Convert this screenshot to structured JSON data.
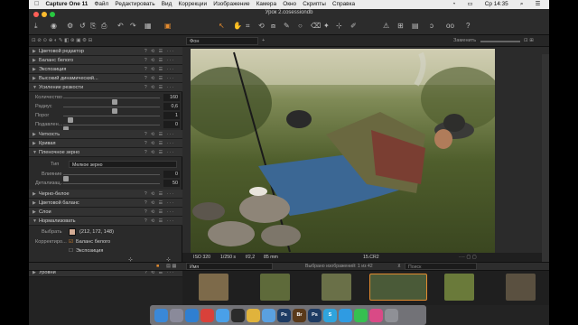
{
  "menubar": {
    "apple": "",
    "app": "Capture One 11",
    "items": [
      "Файл",
      "Редактировать",
      "Вид",
      "Коррекции",
      "Изображение",
      "Камера",
      "Окно",
      "Скрипты",
      "Справка"
    ],
    "time": "Ср 14:35"
  },
  "window": {
    "title": "Урок 2.cosessiondb"
  },
  "subbar": {
    "preset": "Фон",
    "apply_label": "Заменить"
  },
  "panel": {
    "white_editor": "Цветовой редактор",
    "white_balance": "Баланс белого",
    "exposure": "Экспозиция",
    "hdr": "Высокий динамический...",
    "sharpening": {
      "title": "Усиление резкости",
      "params": [
        {
          "label": "Количество",
          "value": "160",
          "pos": 0.5
        },
        {
          "label": "Радиус",
          "value": "0,6",
          "pos": 0.5
        },
        {
          "label": "Порог",
          "value": "1",
          "pos": 0.05
        },
        {
          "label": "Подавлен...",
          "value": "0",
          "pos": 0.0
        }
      ]
    },
    "clarity": "Четкость",
    "curve": "Кривая",
    "film_grain": {
      "title": "Пленочное зерно",
      "type_label": "Тип",
      "type_value": "Мелкое зерно",
      "params": [
        {
          "label": "Влияние",
          "value": "0",
          "pos": 0.0
        },
        {
          "label": "Детализац...",
          "value": "50",
          "pos": 0.5
        }
      ]
    },
    "bw": "Черно-белое",
    "color_balance": "Цветовой баланс",
    "layers": "Слои",
    "normalize": {
      "title": "Нормализовать",
      "pick_label": "Выбрать",
      "pick_value": "(212, 172, 148)",
      "correct_label": "Корректиро...",
      "check1": "Баланс белого",
      "check2": "Экспозиция",
      "swatch": "#d4ac94"
    },
    "levels": "Уровни"
  },
  "viewer": {
    "iso": "ISO 320",
    "shutter": "1/250 s",
    "aperture": "f/2,2",
    "focal": "85 mm",
    "filename": "15.CR2"
  },
  "browser": {
    "sort": "Имя",
    "selected": "Выбрано изображений: 1 из 42",
    "search_placeholder": "Поиск"
  },
  "dock": {
    "apps": [
      {
        "name": "finder",
        "label": "",
        "color": "#3a88d8"
      },
      {
        "name": "launchpad",
        "label": "",
        "color": "#8a8a9a"
      },
      {
        "name": "safari",
        "label": "",
        "color": "#2f7fd1"
      },
      {
        "name": "chrome",
        "label": "",
        "color": "#d9413a"
      },
      {
        "name": "mail",
        "label": "",
        "color": "#4aa0e8"
      },
      {
        "name": "capture-one",
        "label": "",
        "color": "#2b2b2b"
      },
      {
        "name": "chrome2",
        "label": "",
        "color": "#e0b33c"
      },
      {
        "name": "finder2",
        "label": "",
        "color": "#5aa0e0"
      },
      {
        "name": "photoshop",
        "label": "Ps",
        "color": "#1d3b63"
      },
      {
        "name": "bridge",
        "label": "Br",
        "color": "#5a3a1a"
      },
      {
        "name": "premiere",
        "label": "Ps",
        "color": "#1d3b63"
      },
      {
        "name": "skype",
        "label": "S",
        "color": "#2fa4dd"
      },
      {
        "name": "telegram",
        "label": "",
        "color": "#2f9be2"
      },
      {
        "name": "whatsapp",
        "label": "",
        "color": "#36c050"
      },
      {
        "name": "itunes",
        "label": "",
        "color": "#d94a86"
      },
      {
        "name": "trash",
        "label": "",
        "color": "#8f9096"
      }
    ]
  }
}
